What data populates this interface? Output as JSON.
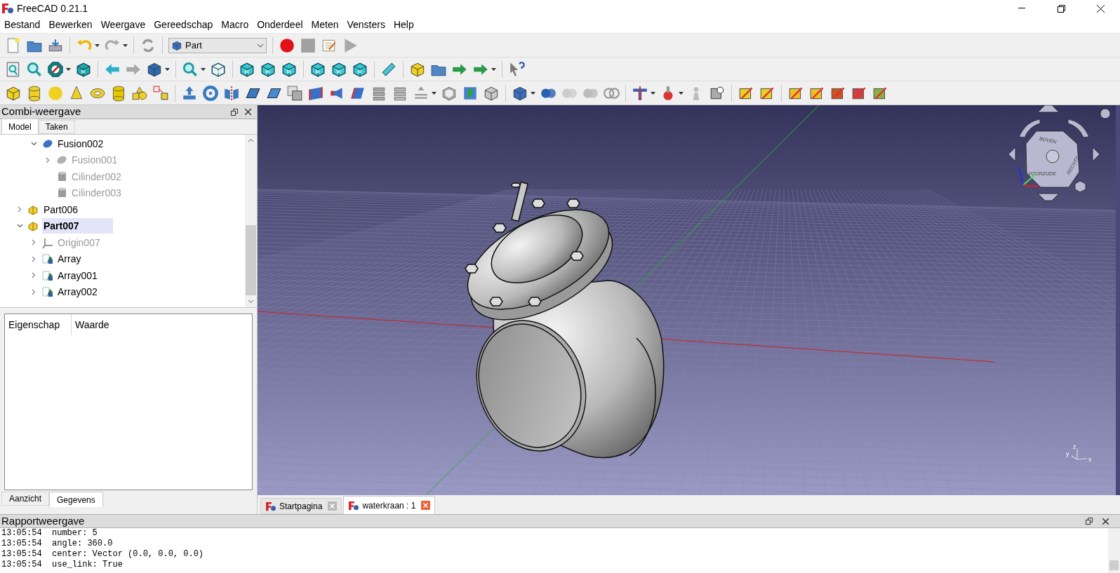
{
  "window": {
    "title": "FreeCAD 0.21.1"
  },
  "menu": [
    "Bestand",
    "Bewerken",
    "Weergave",
    "Gereedschap",
    "Macro",
    "Onderdeel",
    "Meten",
    "Vensters",
    "Help"
  ],
  "workbench_selector": {
    "value": "Part"
  },
  "combi_panel": {
    "title": "Combi-weergave",
    "tabs": [
      {
        "label": "Model",
        "selected": true
      },
      {
        "label": "Taken",
        "selected": false
      }
    ],
    "tree": {
      "scrolled_parent_children": [
        {
          "label": "Fusion002",
          "kind": "fusion",
          "visible": true,
          "selected": false,
          "expanded": true,
          "children": [
            {
              "label": "Fusion001",
              "kind": "fusion",
              "visible": false,
              "selected": false,
              "expanded": false
            },
            {
              "label": "Cilinder002",
              "kind": "cylinder",
              "visible": false,
              "selected": false
            },
            {
              "label": "Cilinder003",
              "kind": "cylinder",
              "visible": false,
              "selected": false
            }
          ]
        }
      ],
      "items": [
        {
          "label": "Part006",
          "kind": "part",
          "visible": true,
          "selected": false,
          "expanded": false
        },
        {
          "label": "Part007",
          "kind": "part",
          "visible": true,
          "selected": true,
          "expanded": true,
          "children": [
            {
              "label": "Origin007",
              "kind": "origin",
              "visible": false,
              "selected": false,
              "expanded": false
            },
            {
              "label": "Array",
              "kind": "array",
              "visible": true,
              "selected": false,
              "expanded": false
            },
            {
              "label": "Array001",
              "kind": "array",
              "visible": true,
              "selected": false,
              "expanded": false
            },
            {
              "label": "Array002",
              "kind": "array",
              "visible": true,
              "selected": false,
              "expanded": false
            }
          ]
        }
      ]
    },
    "property_columns": [
      "Eigenschap",
      "Waarde"
    ],
    "bottom_tabs": [
      {
        "label": "Aanzicht",
        "selected": false
      },
      {
        "label": "Gegevens",
        "selected": true
      }
    ]
  },
  "viewport": {
    "nav_cube_labels": [
      "BOVEN",
      "RECHTS",
      "VOORZIJDE"
    ],
    "axis_labels": [
      "z",
      "y",
      "x"
    ]
  },
  "document_tabs": [
    {
      "label": "Startpagina",
      "selected": false
    },
    {
      "label": "waterkraan : 1",
      "selected": true
    }
  ],
  "report_view": {
    "title": "Rapportweergave",
    "lines": [
      {
        "time": "13:05:54",
        "text": "number: 5"
      },
      {
        "time": "13:05:54",
        "text": "angle: 360.0"
      },
      {
        "time": "13:05:54",
        "text": "center: Vector (0.0, 0.0, 0.0)"
      },
      {
        "time": "13:05:54",
        "text": "use_link: True"
      }
    ]
  }
}
